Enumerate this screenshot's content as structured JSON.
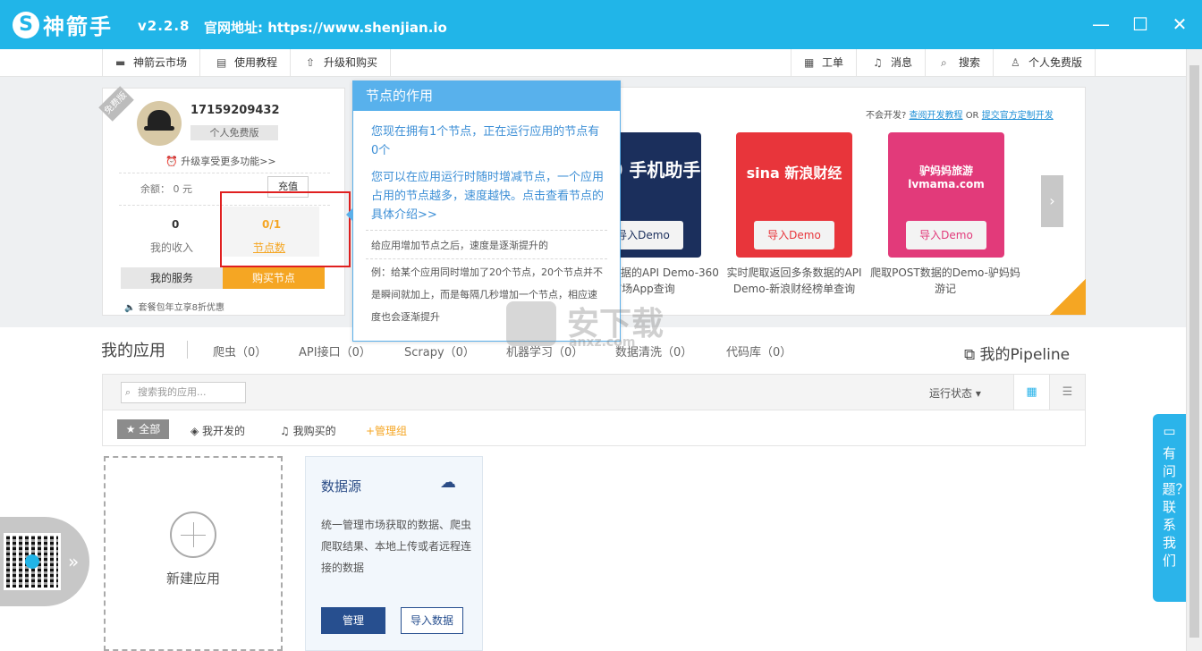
{
  "titlebar": {
    "logo_mark": "S",
    "app_name": "神箭手",
    "version": "v2.2.8",
    "site": "官网地址: https://www.shenjian.io",
    "minimize": "—",
    "maximize": "☐",
    "close": "✕"
  },
  "nav": {
    "left": [
      {
        "icon": "▬",
        "label": "神箭云市场"
      },
      {
        "icon": "▤",
        "label": "使用教程"
      },
      {
        "icon": "⇧",
        "label": "升级和购买"
      }
    ],
    "right": [
      {
        "icon": "▦",
        "label": "工单"
      },
      {
        "icon": "♫",
        "label": "消息"
      },
      {
        "icon": "⌕",
        "label": "搜索"
      },
      {
        "icon": "♙",
        "label": "个人免费版"
      }
    ]
  },
  "user": {
    "ribbon": "免费版",
    "username": "17159209432",
    "edition": "个人免费版",
    "upgrade": "升级享受更多功能>>",
    "balance": "余额： 0 元",
    "recharge": "充值",
    "income_value": "0",
    "income_label": "我的收入",
    "nodes_value": "0/1",
    "nodes_label": "节点数",
    "my_services": "我的服务",
    "buy_nodes": "购买节点",
    "promo": "套餐包年立享8折优惠"
  },
  "tooltip": {
    "title": "节点的作用",
    "p1": "您现在拥有1个节点，正在运行应用的节点有0个",
    "p2": "您可以在应用运行时随时增减节点，一个应用占用的节点越多，速度越快。点击查看节点的具体介绍>>",
    "s1": "给应用增加节点之后，速度是逐渐提升的",
    "s2": "例：给某个应用同时增加了20个节点，20个节点并不是瞬间就加上，而是每隔几秒增加一个节点，相应速度也会逐渐提升"
  },
  "demos": {
    "hint_prefix": "不会开发?",
    "hint_link1": "查阅开发教程",
    "hint_or": "OR",
    "hint_link2": "提交官方定制开发",
    "tiles": [
      {
        "brand": "360 手机助手",
        "button": "导入Demo",
        "caption": "爬取网页数据的API Demo-360市场App查询",
        "color": "#1b2f5c"
      },
      {
        "brand": "sina 新浪财经",
        "button": "导入Demo",
        "caption": "实时爬取返回多条数据的API Demo-新浪财经榜单查询",
        "color": "#e8353b"
      },
      {
        "brand": "驴妈妈旅游 lvmama.com",
        "button": "导入Demo",
        "caption": "爬取POST数据的Demo-驴妈妈游记",
        "color": "#e23a7a"
      }
    ],
    "next": "›"
  },
  "apps": {
    "title": "我的应用",
    "tabs": [
      "爬虫（0）",
      "API接口（0）",
      "Scrapy（0）",
      "机器学习（0）",
      "数据清洗（0）",
      "代码库（0）"
    ],
    "pipeline": "我的Pipeline",
    "search_placeholder": "搜索我的应用...",
    "run_state": "运行状态",
    "filters": {
      "all": "全部",
      "developed": "我开发的",
      "bought": "我购买的",
      "manage_group": "+管理组"
    },
    "new_app": "新建应用",
    "datasource": {
      "title": "数据源",
      "desc": "统一管理市场获取的数据、爬虫爬取结果、本地上传或者远程连接的数据",
      "manage": "管理",
      "import": "导入数据"
    }
  },
  "help": {
    "text": "有问题？联系我们"
  },
  "watermark": {
    "text": "安下载",
    "url": "anxz.com"
  },
  "colors": {
    "brand": "#21b5e8",
    "accent_orange": "#f5a623",
    "highlight_red": "#e02020",
    "tooltip_blue": "#58b1ec",
    "navy": "#274f8f"
  }
}
